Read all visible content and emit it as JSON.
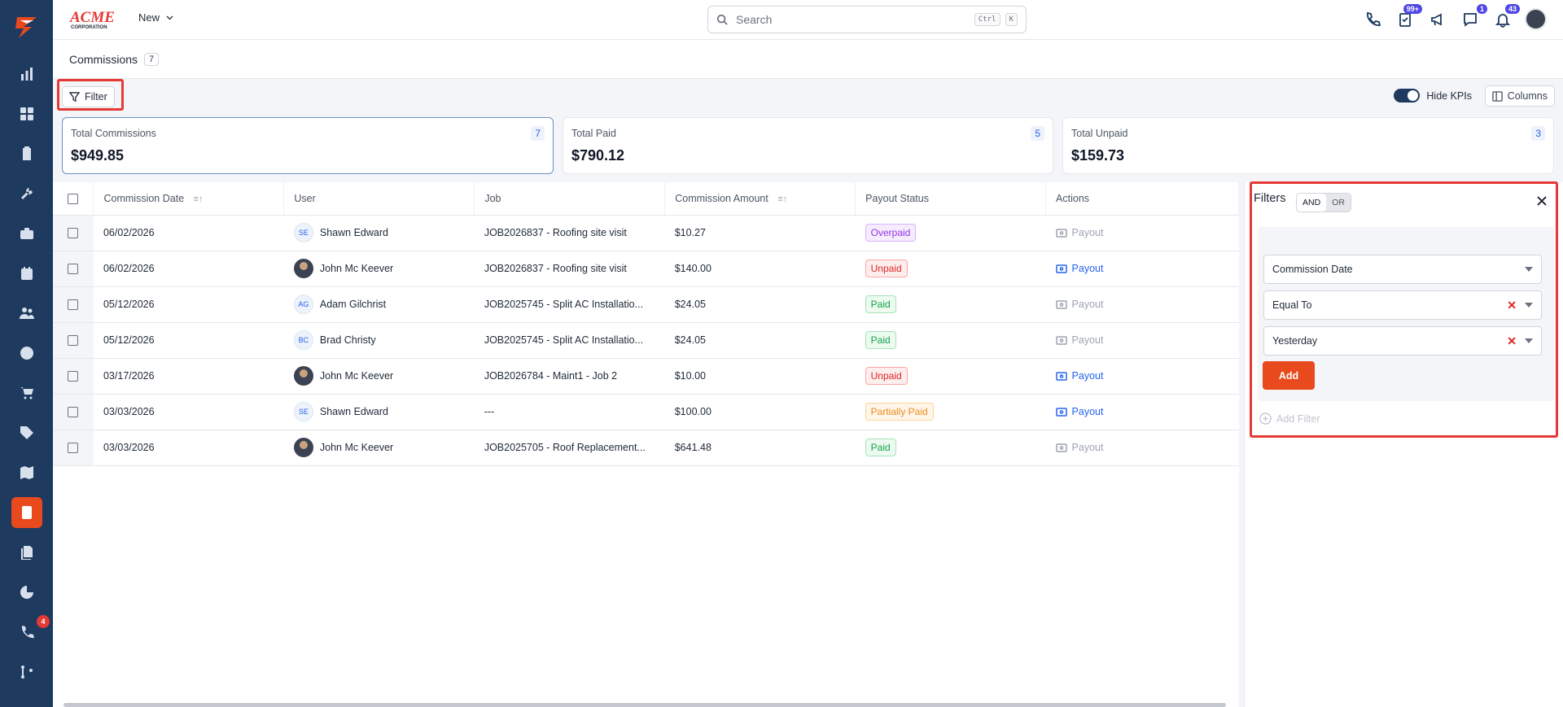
{
  "topbar": {
    "brand_name": "ACME",
    "brand_sub": "CORPORATION",
    "new_label": "New",
    "search_placeholder": "Search",
    "kbd_ctrl": "Ctrl",
    "kbd_k": "K",
    "badge_tasks": "99+",
    "badge_chat": "1",
    "badge_bell": "43"
  },
  "sidebar": {
    "badge_calls": "4"
  },
  "page": {
    "title": "Commissions",
    "count": "7"
  },
  "toolbar": {
    "filter_label": "Filter",
    "hide_kpis_label": "Hide KPIs",
    "columns_label": "Columns"
  },
  "kpis": [
    {
      "label": "Total Commissions",
      "value": "$949.85",
      "count": "7"
    },
    {
      "label": "Total Paid",
      "value": "$790.12",
      "count": "5"
    },
    {
      "label": "Total Unpaid",
      "value": "$159.73",
      "count": "3"
    }
  ],
  "table": {
    "headers": [
      "Commission Date",
      "User",
      "Job",
      "Commission Amount",
      "Payout Status",
      "Actions"
    ],
    "rows": [
      {
        "date": "06/02/2026",
        "user": "Shawn Edward",
        "initials": "SE",
        "photo": false,
        "job": "JOB2026837 - Roofing site visit",
        "amount": "$10.27",
        "status": "Overpaid",
        "status_kind": "over",
        "action": "Payout",
        "action_enabled": false
      },
      {
        "date": "06/02/2026",
        "user": "John Mc Keever",
        "initials": "",
        "photo": true,
        "job": "JOB2026837 - Roofing site visit",
        "amount": "$140.00",
        "status": "Unpaid",
        "status_kind": "unpaid",
        "action": "Payout",
        "action_enabled": true
      },
      {
        "date": "05/12/2026",
        "user": "Adam Gilchrist",
        "initials": "AG",
        "photo": false,
        "job": "JOB2025745 - Split AC Installatio...",
        "amount": "$24.05",
        "status": "Paid",
        "status_kind": "paid",
        "action": "Payout",
        "action_enabled": false
      },
      {
        "date": "05/12/2026",
        "user": "Brad Christy",
        "initials": "BC",
        "photo": false,
        "job": "JOB2025745 - Split AC Installatio...",
        "amount": "$24.05",
        "status": "Paid",
        "status_kind": "paid",
        "action": "Payout",
        "action_enabled": false
      },
      {
        "date": "03/17/2026",
        "user": "John Mc Keever",
        "initials": "",
        "photo": true,
        "job": "JOB2026784 - Maint1 - Job 2",
        "amount": "$10.00",
        "status": "Unpaid",
        "status_kind": "unpaid",
        "action": "Payout",
        "action_enabled": true
      },
      {
        "date": "03/03/2026",
        "user": "Shawn Edward",
        "initials": "SE",
        "photo": false,
        "job": "---",
        "amount": "$100.00",
        "status": "Partially Paid",
        "status_kind": "part",
        "action": "Payout",
        "action_enabled": true
      },
      {
        "date": "03/03/2026",
        "user": "John Mc Keever",
        "initials": "",
        "photo": true,
        "job": "JOB2025705 - Roof Replacement...",
        "amount": "$641.48",
        "status": "Paid",
        "status_kind": "paid",
        "action": "Payout",
        "action_enabled": false
      }
    ]
  },
  "filters_panel": {
    "title": "Filters",
    "and_label": "AND",
    "or_label": "OR",
    "field_value": "Commission Date",
    "operator_value": "Equal To",
    "value_value": "Yesterday",
    "add_label": "Add",
    "add_filter_label": "Add Filter"
  },
  "colors": {
    "sidebar": "#1e3a5f",
    "accent": "#e8491d",
    "link": "#2563eb"
  }
}
